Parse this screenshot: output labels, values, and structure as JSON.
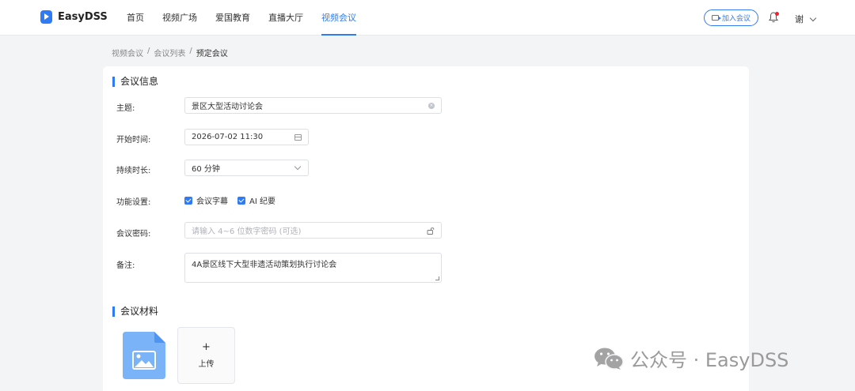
{
  "header": {
    "brand": "EasyDSS",
    "nav": [
      {
        "label": "首页",
        "active": false
      },
      {
        "label": "视频广场",
        "active": false
      },
      {
        "label": "爱国教育",
        "active": false
      },
      {
        "label": "直播大厅",
        "active": false
      },
      {
        "label": "视频会议",
        "active": true
      }
    ],
    "join_button": "加入会议",
    "user_name": "谢"
  },
  "breadcrumb": [
    "视频会议",
    "会议列表",
    "预定会议"
  ],
  "form": {
    "section_info": "会议信息",
    "subject_label": "主题:",
    "subject_value": "景区大型活动讨论会",
    "start_label": "开始时间:",
    "start_value": "2026-07-02 11:30",
    "duration_label": "持续时长:",
    "duration_value": "60 分钟",
    "features_label": "功能设置:",
    "feature_subtitles": "会议字幕",
    "feature_ai": "AI 纪要",
    "password_label": "会议密码:",
    "password_placeholder": "请输入 4~6 位数字密码 (可选)",
    "remark_label": "备注:",
    "remark_value": "4A景区线下大型非遗活动策划执行讨论会",
    "section_materials": "会议材料",
    "upload_label": "上传"
  },
  "watermark": "公众号 · EasyDSS",
  "colors": {
    "accent": "#2f7bf5",
    "file_icon": "#7ab3f7",
    "badge": "#f5222d"
  }
}
